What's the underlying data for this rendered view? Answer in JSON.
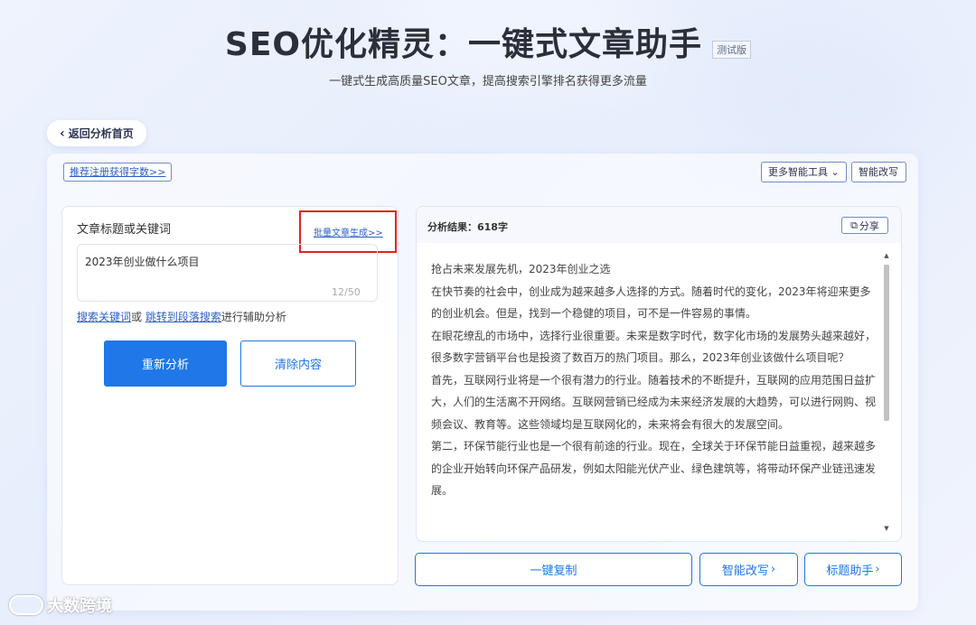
{
  "header": {
    "title": "SEO优化精灵：一键式文章助手",
    "badge": "测试版",
    "subtitle": "一键式生成高质量SEO文章，提高搜索引擎排名获得更多流量"
  },
  "nav": {
    "back_label": "返回分析首页"
  },
  "toolbar": {
    "register_link": "推荐注册获得字数>>",
    "more_tools": "更多智能工具",
    "smart_rewrite": "智能改写"
  },
  "input_panel": {
    "label": "文章标题或关键词",
    "batch_link": "批量文章生成>>",
    "keyword_value": "2023年创业做什么项目",
    "counter": "12/50",
    "helper": {
      "link1": "搜索关键词",
      "conj": "或",
      "link2": "跳转到段落搜索",
      "suffix": "进行辅助分析"
    },
    "reanalyze": "重新分析",
    "clear": "清除内容"
  },
  "result_panel": {
    "status": "分析结果：618字",
    "share": "分享",
    "paragraphs": [
      "抢占未来发展先机，2023年创业之选",
      "在快节奏的社会中，创业成为越来越多人选择的方式。随着时代的变化，2023年将迎来更多的创业机会。但是，找到一个稳健的项目，可不是一件容易的事情。",
      "在眼花缭乱的市场中，选择行业很重要。未来是数字时代，数字化市场的发展势头越来越好，很多数字营销平台也是投资了数百万的热门项目。那么，2023年创业该做什么项目呢？",
      "首先，互联网行业将是一个很有潜力的行业。随着技术的不断提升，互联网的应用范围日益扩大，人们的生活离不开网络。互联网营销已经成为未来经济发展的大趋势，可以进行网购、视频会议、教育等。这些领域均是互联网化的，未来将会有很大的发展空间。",
      "第二，环保节能行业也是一个很有前途的行业。现在，全球关于环保节能日益重视，越来越多的企业开始转向环保产品研发，例如太阳能光伏产业、绿色建筑等，将带动环保产业链迅速发展。"
    ]
  },
  "actions": {
    "copy": "一键复制",
    "smart_rewrite": "智能改写",
    "title_helper": "标题助手"
  },
  "watermark": "大数跨境",
  "colors": {
    "primary": "#1f77e8",
    "link": "#2c5ec7",
    "highlight_box": "#e1241f"
  }
}
